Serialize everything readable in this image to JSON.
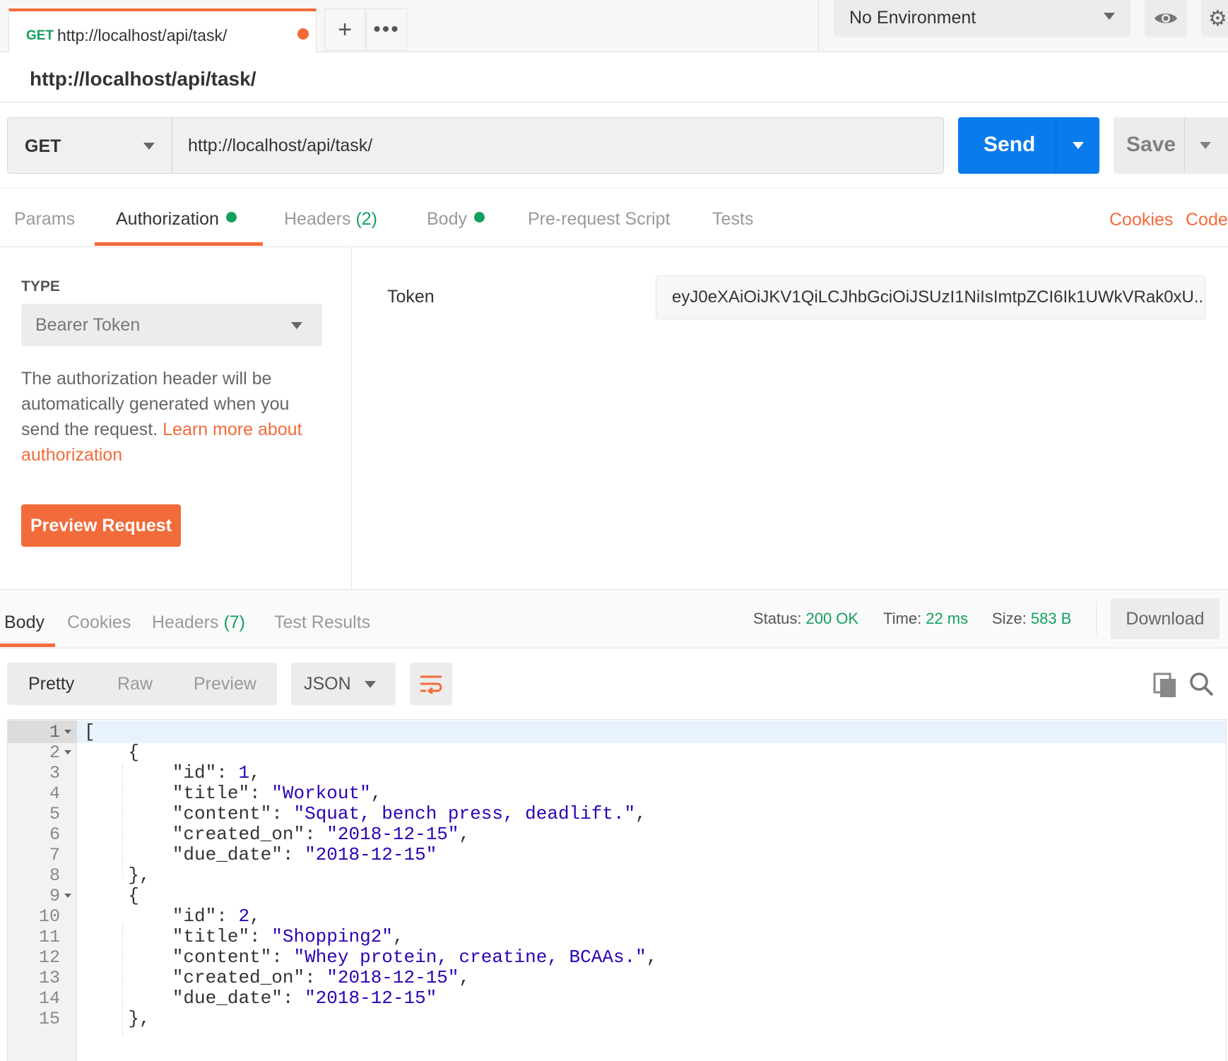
{
  "tab": {
    "method": "GET",
    "url": "http://localhost/api/task/"
  },
  "toolbar": {
    "environment": "No Environment",
    "icons": [
      "plus-icon",
      "more-icon",
      "eye-icon",
      "gear-icon"
    ]
  },
  "request": {
    "title": "http://localhost/api/task/",
    "method": "GET",
    "url": "http://localhost/api/task/",
    "send_label": "Send",
    "save_label": "Save"
  },
  "request_tabs": {
    "params": "Params",
    "authorization": "Authorization",
    "headers": "Headers",
    "headers_count": "(2)",
    "body": "Body",
    "prerequest": "Pre-request Script",
    "tests": "Tests",
    "cookies": "Cookies",
    "code": "Code"
  },
  "auth": {
    "type_label": "TYPE",
    "type_value": "Bearer Token",
    "description": "The authorization header will be automatically generated when you send the request.",
    "learn_more": "Learn more about authorization",
    "preview_button": "Preview Request",
    "token_label": "Token",
    "token_value": "eyJ0eXAiOiJKV1QiLCJhbGciOiJSUzI1NiIsImtpZCI6Ik1UWkVRak0xU..."
  },
  "response_tabs": {
    "body": "Body",
    "cookies": "Cookies",
    "headers": "Headers",
    "headers_count": "(7)",
    "test_results": "Test Results"
  },
  "response_status": {
    "status_label": "Status:",
    "status_value": "200 OK",
    "time_label": "Time:",
    "time_value": "22 ms",
    "size_label": "Size:",
    "size_value": "583 B",
    "download": "Download"
  },
  "response_view": {
    "pretty": "Pretty",
    "raw": "Raw",
    "preview": "Preview",
    "format": "JSON"
  },
  "colors": {
    "accent": "#f26b3a",
    "send": "#097bed",
    "success": "#13a05f",
    "json_value": "#2d00b4"
  },
  "code_lines": [
    {
      "n": "1",
      "text": "["
    },
    {
      "n": "2",
      "text": "    {"
    },
    {
      "n": "3",
      "text": "        \"id\": 1,"
    },
    {
      "n": "4",
      "text": "        \"title\": \"Workout\","
    },
    {
      "n": "5",
      "text": "        \"content\": \"Squat, bench press, deadlift.\","
    },
    {
      "n": "6",
      "text": "        \"created_on\": \"2018-12-15\","
    },
    {
      "n": "7",
      "text": "        \"due_date\": \"2018-12-15\""
    },
    {
      "n": "8",
      "text": "    },"
    },
    {
      "n": "9",
      "text": "    {"
    },
    {
      "n": "10",
      "text": "        \"id\": 2,"
    },
    {
      "n": "11",
      "text": "        \"title\": \"Shopping2\","
    },
    {
      "n": "12",
      "text": "        \"content\": \"Whey protein, creatine, BCAAs.\","
    },
    {
      "n": "13",
      "text": "        \"created_on\": \"2018-12-15\","
    },
    {
      "n": "14",
      "text": "        \"due_date\": \"2018-12-15\""
    },
    {
      "n": "15",
      "text": "    },"
    }
  ]
}
